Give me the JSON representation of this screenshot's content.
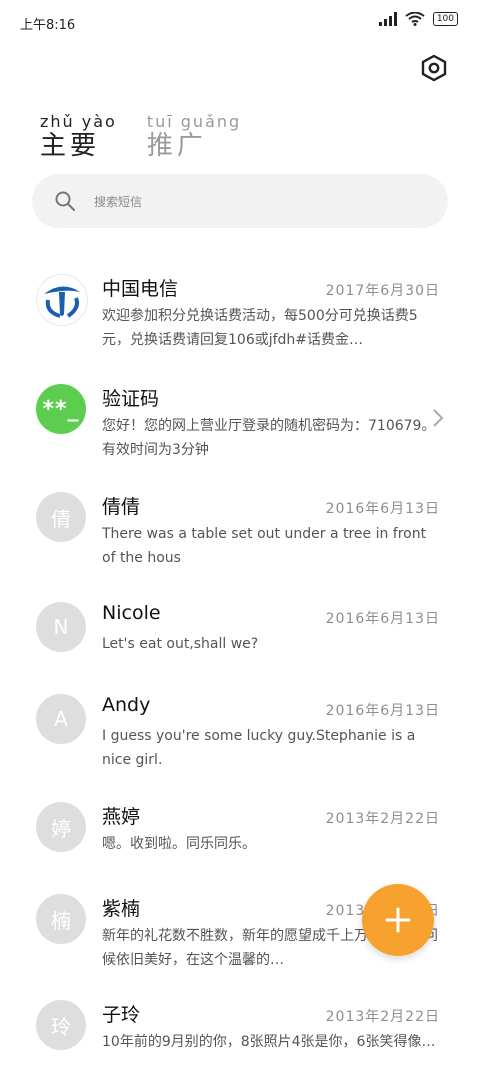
{
  "status_bar": {
    "time": "上午8:16"
  },
  "battery": "100",
  "tabs": [
    {
      "pinyin": "zhǔ yào",
      "label": "主要"
    },
    {
      "pinyin": "tuī guǎng",
      "label": "推广"
    }
  ],
  "search": {
    "placeholder": "搜索短信"
  },
  "messages": [
    {
      "name": "中国电信",
      "date": "2017年6月30日",
      "preview": "欢迎参加积分兑换话费活动，每500分可兑换话费5元，兑换话费请回复106或jfdh#话费金…",
      "avatar": "telecom-logo"
    },
    {
      "name": "验证码",
      "date": "",
      "preview": "您好！您的网上营业厅登录的随机密码为：710679。有效时间为3分钟",
      "avatar_text": "**_"
    },
    {
      "name": "倩倩",
      "date": "2016年6月13日",
      "preview": "There was a table set out under a tree in front of the hous",
      "avatar_text": "倩"
    },
    {
      "name": "Nicole",
      "date": "2016年6月13日",
      "preview": "Let's eat out,shall we?",
      "avatar_text": "N"
    },
    {
      "name": "Andy",
      "date": "2016年6月13日",
      "preview": "I guess you're some lucky guy.Stephanie is a nice girl.",
      "avatar_text": "A"
    },
    {
      "name": "燕婷",
      "date": "2013年2月22日",
      "preview": "嗯。收到啦。同乐同乐。",
      "avatar_text": "婷"
    },
    {
      "name": "紫楠",
      "date": "2013年2月22日",
      "preview": "新年的礼花数不胜数，新年的愿望成千上万，新年的问候依旧美好，在这个温馨的…",
      "avatar_text": "楠"
    },
    {
      "name": "子玲",
      "date": "2013年2月22日",
      "preview": "10年前的9月别的你，8张照片4张是你，6张笑得像…",
      "avatar_text": "玲"
    }
  ],
  "colors": {
    "accent": "#f7a12e",
    "verify_green": "#5ccd4e",
    "avatar_gray": "#dedede",
    "telecom_blue": "#1b5fb0"
  }
}
